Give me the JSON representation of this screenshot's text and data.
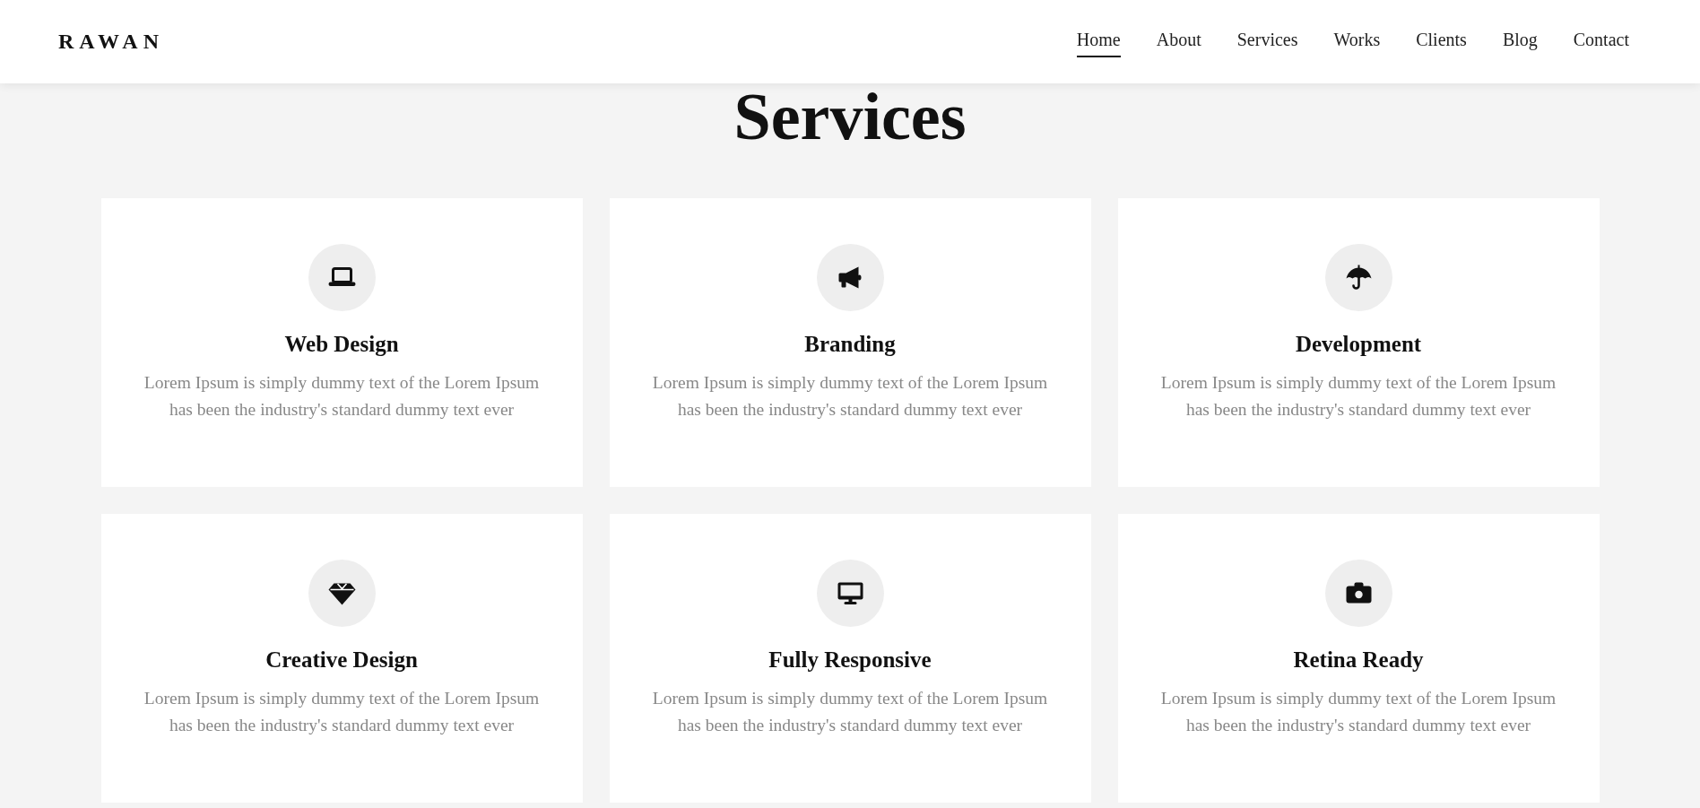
{
  "header": {
    "logo": "RAWAN",
    "nav": [
      {
        "label": "Home",
        "selected": true
      },
      {
        "label": "About",
        "selected": false
      },
      {
        "label": "Services",
        "selected": false
      },
      {
        "label": "Works",
        "selected": false
      },
      {
        "label": "Clients",
        "selected": false
      },
      {
        "label": "Blog",
        "selected": false
      },
      {
        "label": "Contact",
        "selected": false
      }
    ]
  },
  "section": {
    "title": "Services",
    "services": [
      {
        "kind": "laptop",
        "title": "Web Design",
        "description": "Lorem Ipsum is simply dummy text of the Lorem Ipsum has been the industry's standard dummy text ever"
      },
      {
        "kind": "megaphone",
        "title": "Branding",
        "description": "Lorem Ipsum is simply dummy text of the Lorem Ipsum has been the industry's standard dummy text ever"
      },
      {
        "kind": "umbrella",
        "title": "Development",
        "description": "Lorem Ipsum is simply dummy text of the Lorem Ipsum has been the industry's standard dummy text ever"
      },
      {
        "kind": "diamond",
        "title": "Creative Design",
        "description": "Lorem Ipsum is simply dummy text of the Lorem Ipsum has been the industry's standard dummy text ever"
      },
      {
        "kind": "monitor",
        "title": "Fully Responsive",
        "description": "Lorem Ipsum is simply dummy text of the Lorem Ipsum has been the industry's standard dummy text ever"
      },
      {
        "kind": "camera",
        "title": "Retina Ready",
        "description": "Lorem Ipsum is simply dummy text of the Lorem Ipsum has been the industry's standard dummy text ever"
      }
    ]
  }
}
